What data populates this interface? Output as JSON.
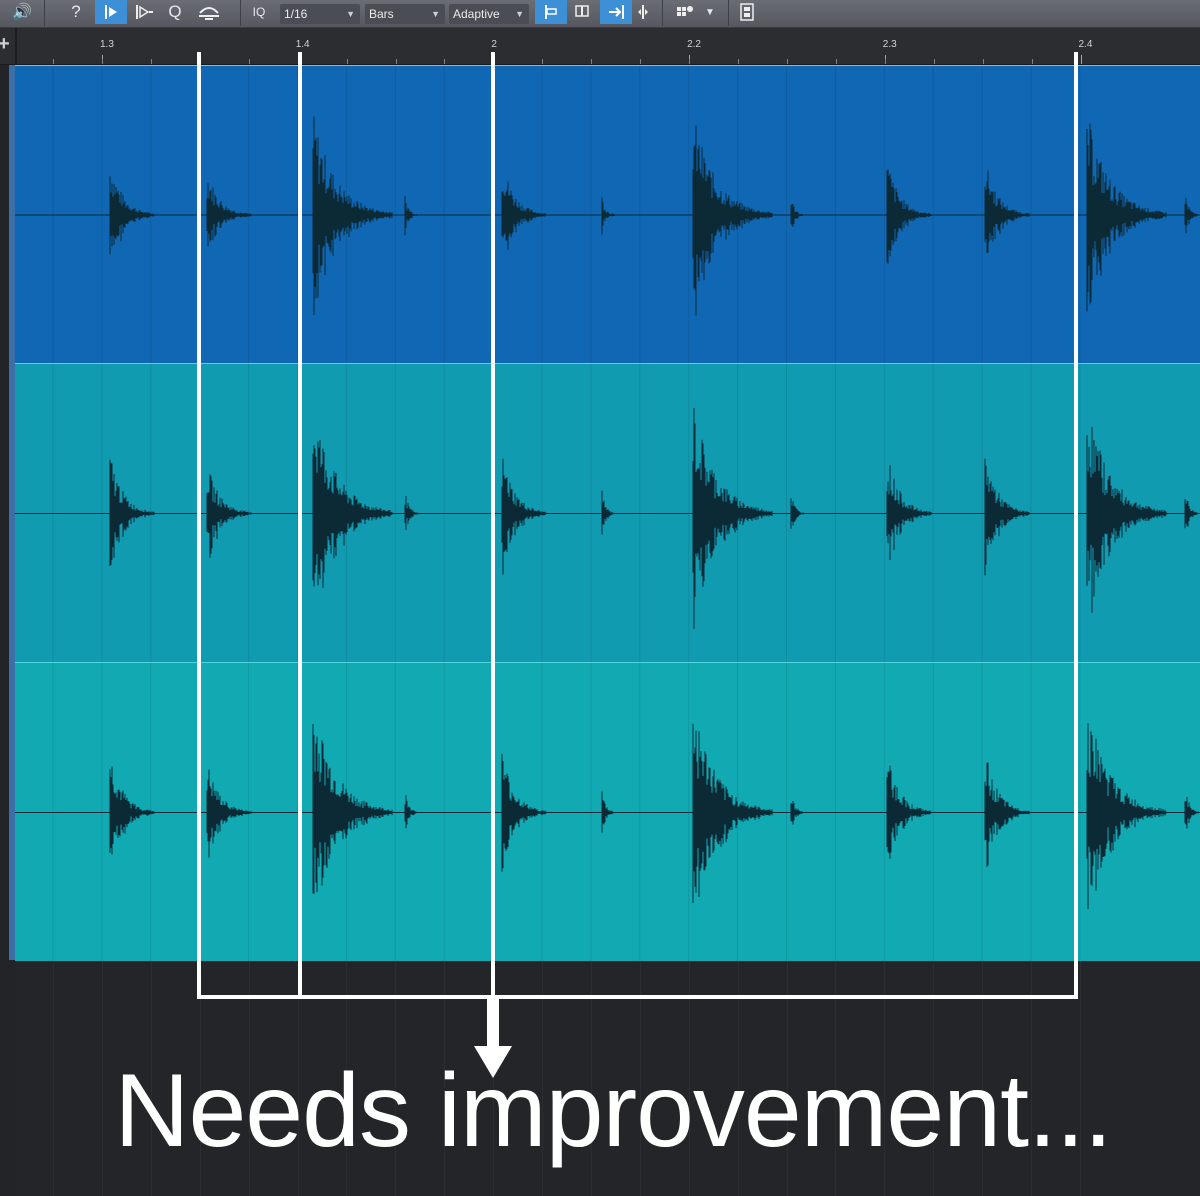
{
  "toolbar": {
    "quantize_label": "IQ",
    "grid_value": "1/16",
    "timebase": "Bars",
    "snap_mode": "Adaptive",
    "icons": [
      "speaker-icon",
      "help-icon",
      "snap-icon",
      "event-snap-icon",
      "quantize-icon",
      "transient-icon",
      "align-left-icon",
      "cursor-icon",
      "follow-icon",
      "split-icon",
      "grid-add-icon",
      "film-icon"
    ]
  },
  "ruler": {
    "ticks": [
      {
        "label": "1.3",
        "bar": 1.3
      },
      {
        "label": "1.4",
        "bar": 1.4
      },
      {
        "label": "2",
        "bar": 2
      },
      {
        "label": "2.2",
        "bar": 2.2
      },
      {
        "label": "2.3",
        "bar": 2.3
      },
      {
        "label": "2.4",
        "bar": 2.4
      }
    ]
  },
  "tracks": [
    {
      "color": "#1068b4",
      "border": "#4fd6e0"
    },
    {
      "color": "#119bb0",
      "border": "#4fd6e0"
    },
    {
      "color": "#11aab3",
      "border": "#4fd6e0"
    }
  ],
  "annotation": {
    "text": "Needs improvement...",
    "color": "#ffffff"
  }
}
